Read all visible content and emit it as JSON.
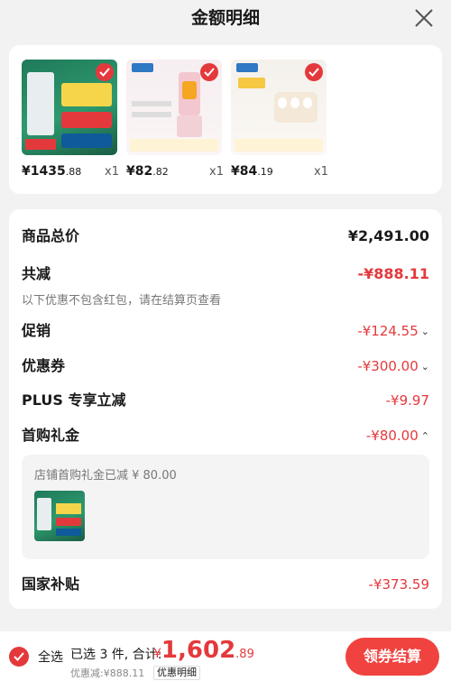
{
  "header": {
    "title": "金额明细"
  },
  "products": [
    {
      "price_main": "¥1435",
      "price_dec": ".88",
      "qty": "x1"
    },
    {
      "price_main": "¥82",
      "price_dec": ".82",
      "qty": "x1"
    },
    {
      "price_main": "¥84",
      "price_dec": ".19",
      "qty": "x1"
    }
  ],
  "detail": {
    "total_label": "商品总价",
    "total_value": "¥2,491.00",
    "reduce_label": "共减",
    "reduce_value": "-¥888.11",
    "reduce_note": "以下优惠不包含红包，请在结算页查看",
    "promo_label": "促销",
    "promo_value": "-¥124.55",
    "coupon_label": "优惠券",
    "coupon_value": "-¥300.00",
    "plus_label": "PLUS 专享立减",
    "plus_value": "-¥9.97",
    "gift_label": "首购礼金",
    "gift_value": "-¥80.00",
    "gift_note": "店铺首购礼金已减 ¥ 80.00",
    "subsidy_label": "国家补贴",
    "subsidy_value": "-¥373.59"
  },
  "footer": {
    "select_all": "全选",
    "selected": "已选 3 件, 合计:",
    "currency": "¥",
    "total_int": "1,602",
    "total_dec": ".89",
    "discount": "优惠减:¥888.11",
    "detail_link": "优惠明细",
    "pay_button": "领券结算"
  },
  "colors": {
    "accent": "#e4393c",
    "button": "#f0433f"
  }
}
